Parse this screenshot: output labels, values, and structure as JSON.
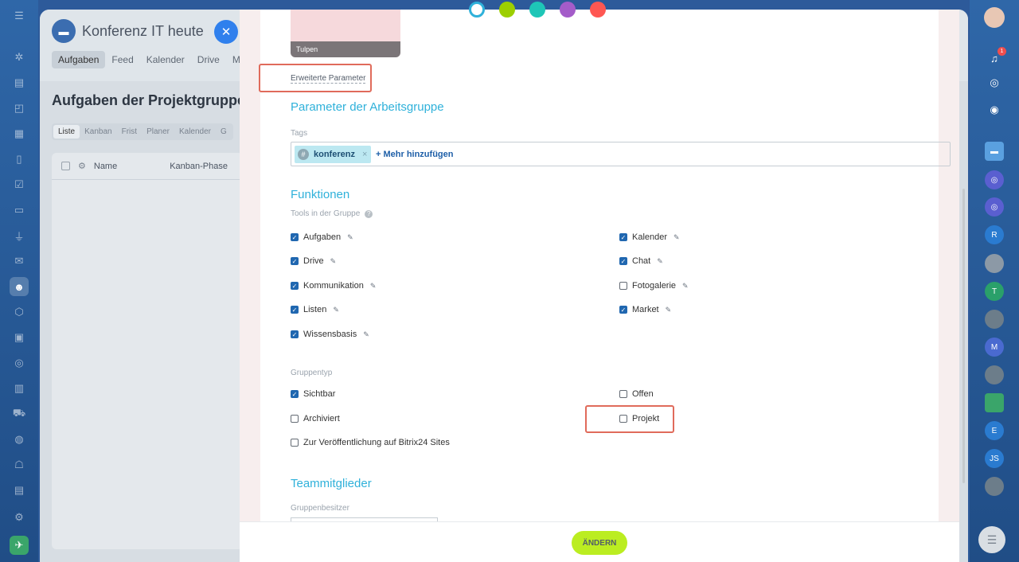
{
  "background": {
    "group_title": "Konferenz IT heute",
    "tabs": [
      "Aufgaben",
      "Feed",
      "Kalender",
      "Drive",
      "M"
    ],
    "heading": "Aufgaben der Projektgruppe",
    "subtabs": [
      "Liste",
      "Kanban",
      "Frist",
      "Planer",
      "Kalender",
      "G"
    ],
    "columns": [
      "Name",
      "Kanban-Phase"
    ]
  },
  "right_sidebar": {
    "notification_count": "1",
    "avatar_letters": [
      "R",
      "T",
      "M",
      "E",
      "JS"
    ]
  },
  "form": {
    "image_caption": "Tulpen",
    "advanced_link": "Erweiterte Parameter",
    "section_params": "Parameter der Arbeitsgruppe",
    "tags_label": "Tags",
    "tag_value": "konferenz",
    "tag_add": "+ Mehr hinzufügen",
    "section_functions": "Funktionen",
    "tools_label": "Tools in der Gruppe",
    "tools_left": [
      {
        "label": "Aufgaben",
        "checked": true
      },
      {
        "label": "Drive",
        "checked": true
      },
      {
        "label": "Kommunikation",
        "checked": true
      },
      {
        "label": "Listen",
        "checked": true
      },
      {
        "label": "Wissensbasis",
        "checked": true
      }
    ],
    "tools_right": [
      {
        "label": "Kalender",
        "checked": true
      },
      {
        "label": "Chat",
        "checked": true
      },
      {
        "label": "Fotogalerie",
        "checked": false
      },
      {
        "label": "Market",
        "checked": true
      }
    ],
    "group_type_label": "Gruppentyp",
    "type_visible": "Sichtbar",
    "type_open": "Offen",
    "type_archived": "Archiviert",
    "type_project": "Projekt",
    "type_sites": "Zur Veröffentlichung auf Bitrix24 Sites",
    "section_team": "Teammitglieder",
    "owner_label": "Gruppenbesitzer",
    "save_label": "ÄNDERN"
  },
  "colors": {
    "accent": "#2fb1da",
    "save": "#bbed21",
    "highlight": "#e06b5b",
    "checkbox": "#2067b0"
  }
}
